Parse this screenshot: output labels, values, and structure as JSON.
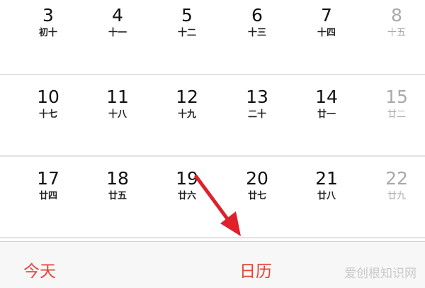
{
  "calendar": {
    "weeks": [
      [
        {
          "day": "3",
          "lunar": "初十"
        },
        {
          "day": "4",
          "lunar": "十一"
        },
        {
          "day": "5",
          "lunar": "十二"
        },
        {
          "day": "6",
          "lunar": "十三"
        },
        {
          "day": "7",
          "lunar": "十四"
        },
        {
          "day": "8",
          "lunar": "十五"
        }
      ],
      [
        {
          "day": "10",
          "lunar": "十七"
        },
        {
          "day": "11",
          "lunar": "十八"
        },
        {
          "day": "12",
          "lunar": "十九"
        },
        {
          "day": "13",
          "lunar": "二十"
        },
        {
          "day": "14",
          "lunar": "廿一"
        },
        {
          "day": "15",
          "lunar": "廿二"
        }
      ],
      [
        {
          "day": "17",
          "lunar": "廿四"
        },
        {
          "day": "18",
          "lunar": "廿五"
        },
        {
          "day": "19",
          "lunar": "廿六"
        },
        {
          "day": "20",
          "lunar": "廿七"
        },
        {
          "day": "21",
          "lunar": "廿八"
        },
        {
          "day": "22",
          "lunar": "廿九"
        }
      ]
    ]
  },
  "tabbar": {
    "today_label": "今天",
    "calendar_label": "日历"
  },
  "watermark": "爱创根知识网",
  "colors": {
    "accent": "#e54339",
    "weekend_text": "#a9a9a9",
    "arrow": "#e0202a"
  }
}
